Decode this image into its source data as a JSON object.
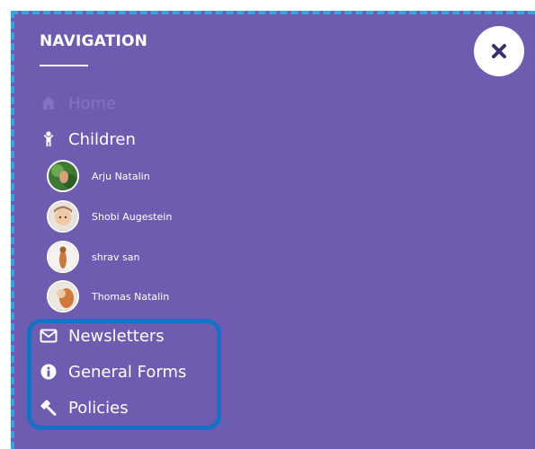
{
  "nav": {
    "title": "NAVIGATION",
    "close_icon": "close-icon",
    "items": {
      "home": {
        "label": "Home",
        "icon": "home-icon"
      },
      "children": {
        "label": "Children",
        "icon": "child-icon"
      },
      "newsletters": {
        "label": "Newsletters",
        "icon": "envelope-icon"
      },
      "general_forms": {
        "label": "General Forms",
        "icon": "info-circle-icon"
      },
      "policies": {
        "label": "Policies",
        "icon": "gavel-icon"
      }
    },
    "children_list": [
      {
        "name": "Arju Natalin"
      },
      {
        "name": "Shobi Augestein"
      },
      {
        "name": "shrav san"
      },
      {
        "name": "Thomas Natalin"
      }
    ]
  },
  "colors": {
    "panel_bg": "#6e5cb0",
    "highlight": "#1671c6",
    "dashed_border": "#2fa8e0"
  }
}
